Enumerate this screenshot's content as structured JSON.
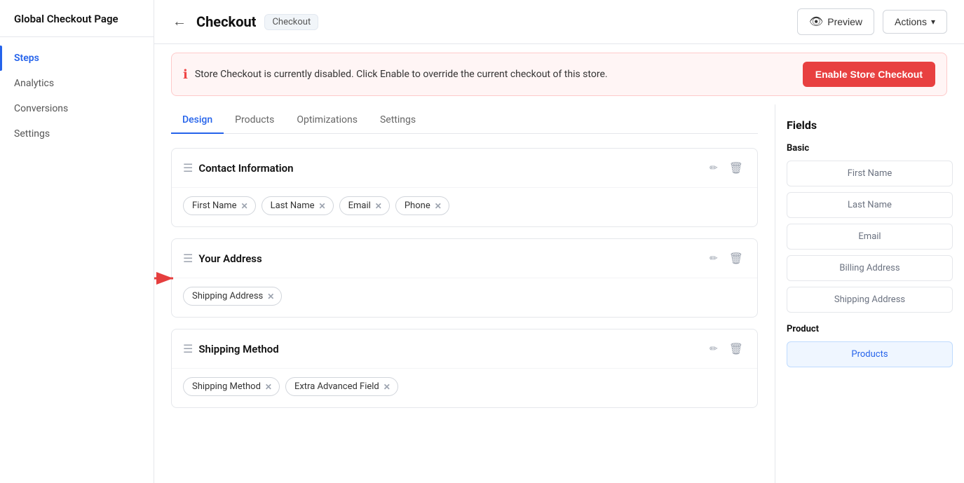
{
  "sidebar": {
    "title": "Global Checkout Page",
    "items": [
      {
        "id": "steps",
        "label": "Steps",
        "active": true
      },
      {
        "id": "analytics",
        "label": "Analytics",
        "active": false
      },
      {
        "id": "conversions",
        "label": "Conversions",
        "active": false
      },
      {
        "id": "settings",
        "label": "Settings",
        "active": false
      }
    ]
  },
  "header": {
    "back_label": "←",
    "page_title": "Checkout",
    "badge_label": "Checkout",
    "preview_label": "Preview",
    "actions_label": "Actions",
    "actions_arrow": "↓"
  },
  "alert": {
    "icon": "ℹ",
    "text": "Store Checkout is currently disabled. Click Enable to override the current checkout of this store.",
    "button_label": "Enable Store Checkout"
  },
  "tabs": [
    {
      "id": "design",
      "label": "Design",
      "active": true
    },
    {
      "id": "products",
      "label": "Products",
      "active": false
    },
    {
      "id": "optimizations",
      "label": "Optimizations",
      "active": false
    },
    {
      "id": "settings",
      "label": "Settings",
      "active": false
    }
  ],
  "sections": [
    {
      "id": "contact-information",
      "title": "Contact Information",
      "fields": [
        {
          "id": "first-name",
          "label": "First Name"
        },
        {
          "id": "last-name",
          "label": "Last Name"
        },
        {
          "id": "email",
          "label": "Email"
        },
        {
          "id": "phone",
          "label": "Phone"
        }
      ]
    },
    {
      "id": "your-address",
      "title": "Your Address",
      "fields": [
        {
          "id": "shipping-address",
          "label": "Shipping Address"
        }
      ]
    },
    {
      "id": "shipping-method",
      "title": "Shipping Method",
      "fields": [
        {
          "id": "shipping-method",
          "label": "Shipping Method"
        },
        {
          "id": "extra-advanced-field",
          "label": "Extra Advanced Field"
        }
      ]
    }
  ],
  "fields_panel": {
    "title": "Fields",
    "basic_label": "Basic",
    "basic_fields": [
      {
        "id": "first-name",
        "label": "First Name",
        "highlighted": false
      },
      {
        "id": "last-name",
        "label": "Last Name",
        "highlighted": false
      },
      {
        "id": "email",
        "label": "Email",
        "highlighted": false
      },
      {
        "id": "billing-address",
        "label": "Billing Address",
        "highlighted": false
      },
      {
        "id": "shipping-address",
        "label": "Shipping Address",
        "highlighted": false
      }
    ],
    "product_label": "Product",
    "product_fields": [
      {
        "id": "products",
        "label": "Products",
        "highlighted": true
      }
    ]
  }
}
